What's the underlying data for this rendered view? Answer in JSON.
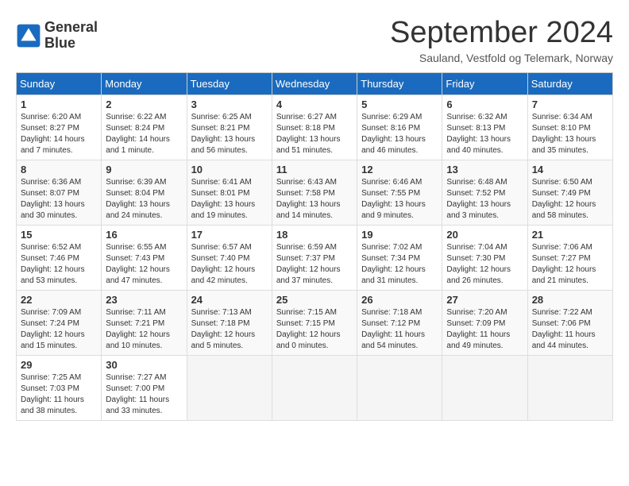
{
  "header": {
    "logo_line1": "General",
    "logo_line2": "Blue",
    "month_title": "September 2024",
    "subtitle": "Sauland, Vestfold og Telemark, Norway"
  },
  "weekdays": [
    "Sunday",
    "Monday",
    "Tuesday",
    "Wednesday",
    "Thursday",
    "Friday",
    "Saturday"
  ],
  "weeks": [
    [
      {
        "day": "1",
        "sunrise": "6:20 AM",
        "sunset": "8:27 PM",
        "daylight": "14 hours and 7 minutes."
      },
      {
        "day": "2",
        "sunrise": "6:22 AM",
        "sunset": "8:24 PM",
        "daylight": "14 hours and 1 minute."
      },
      {
        "day": "3",
        "sunrise": "6:25 AM",
        "sunset": "8:21 PM",
        "daylight": "13 hours and 56 minutes."
      },
      {
        "day": "4",
        "sunrise": "6:27 AM",
        "sunset": "8:18 PM",
        "daylight": "13 hours and 51 minutes."
      },
      {
        "day": "5",
        "sunrise": "6:29 AM",
        "sunset": "8:16 PM",
        "daylight": "13 hours and 46 minutes."
      },
      {
        "day": "6",
        "sunrise": "6:32 AM",
        "sunset": "8:13 PM",
        "daylight": "13 hours and 40 minutes."
      },
      {
        "day": "7",
        "sunrise": "6:34 AM",
        "sunset": "8:10 PM",
        "daylight": "13 hours and 35 minutes."
      }
    ],
    [
      {
        "day": "8",
        "sunrise": "6:36 AM",
        "sunset": "8:07 PM",
        "daylight": "13 hours and 30 minutes."
      },
      {
        "day": "9",
        "sunrise": "6:39 AM",
        "sunset": "8:04 PM",
        "daylight": "13 hours and 24 minutes."
      },
      {
        "day": "10",
        "sunrise": "6:41 AM",
        "sunset": "8:01 PM",
        "daylight": "13 hours and 19 minutes."
      },
      {
        "day": "11",
        "sunrise": "6:43 AM",
        "sunset": "7:58 PM",
        "daylight": "13 hours and 14 minutes."
      },
      {
        "day": "12",
        "sunrise": "6:46 AM",
        "sunset": "7:55 PM",
        "daylight": "13 hours and 9 minutes."
      },
      {
        "day": "13",
        "sunrise": "6:48 AM",
        "sunset": "7:52 PM",
        "daylight": "13 hours and 3 minutes."
      },
      {
        "day": "14",
        "sunrise": "6:50 AM",
        "sunset": "7:49 PM",
        "daylight": "12 hours and 58 minutes."
      }
    ],
    [
      {
        "day": "15",
        "sunrise": "6:52 AM",
        "sunset": "7:46 PM",
        "daylight": "12 hours and 53 minutes."
      },
      {
        "day": "16",
        "sunrise": "6:55 AM",
        "sunset": "7:43 PM",
        "daylight": "12 hours and 47 minutes."
      },
      {
        "day": "17",
        "sunrise": "6:57 AM",
        "sunset": "7:40 PM",
        "daylight": "12 hours and 42 minutes."
      },
      {
        "day": "18",
        "sunrise": "6:59 AM",
        "sunset": "7:37 PM",
        "daylight": "12 hours and 37 minutes."
      },
      {
        "day": "19",
        "sunrise": "7:02 AM",
        "sunset": "7:34 PM",
        "daylight": "12 hours and 31 minutes."
      },
      {
        "day": "20",
        "sunrise": "7:04 AM",
        "sunset": "7:30 PM",
        "daylight": "12 hours and 26 minutes."
      },
      {
        "day": "21",
        "sunrise": "7:06 AM",
        "sunset": "7:27 PM",
        "daylight": "12 hours and 21 minutes."
      }
    ],
    [
      {
        "day": "22",
        "sunrise": "7:09 AM",
        "sunset": "7:24 PM",
        "daylight": "12 hours and 15 minutes."
      },
      {
        "day": "23",
        "sunrise": "7:11 AM",
        "sunset": "7:21 PM",
        "daylight": "12 hours and 10 minutes."
      },
      {
        "day": "24",
        "sunrise": "7:13 AM",
        "sunset": "7:18 PM",
        "daylight": "12 hours and 5 minutes."
      },
      {
        "day": "25",
        "sunrise": "7:15 AM",
        "sunset": "7:15 PM",
        "daylight": "12 hours and 0 minutes."
      },
      {
        "day": "26",
        "sunrise": "7:18 AM",
        "sunset": "7:12 PM",
        "daylight": "11 hours and 54 minutes."
      },
      {
        "day": "27",
        "sunrise": "7:20 AM",
        "sunset": "7:09 PM",
        "daylight": "11 hours and 49 minutes."
      },
      {
        "day": "28",
        "sunrise": "7:22 AM",
        "sunset": "7:06 PM",
        "daylight": "11 hours and 44 minutes."
      }
    ],
    [
      {
        "day": "29",
        "sunrise": "7:25 AM",
        "sunset": "7:03 PM",
        "daylight": "11 hours and 38 minutes."
      },
      {
        "day": "30",
        "sunrise": "7:27 AM",
        "sunset": "7:00 PM",
        "daylight": "11 hours and 33 minutes."
      },
      {
        "day": "",
        "sunrise": "",
        "sunset": "",
        "daylight": ""
      },
      {
        "day": "",
        "sunrise": "",
        "sunset": "",
        "daylight": ""
      },
      {
        "day": "",
        "sunrise": "",
        "sunset": "",
        "daylight": ""
      },
      {
        "day": "",
        "sunrise": "",
        "sunset": "",
        "daylight": ""
      },
      {
        "day": "",
        "sunrise": "",
        "sunset": "",
        "daylight": ""
      }
    ]
  ]
}
